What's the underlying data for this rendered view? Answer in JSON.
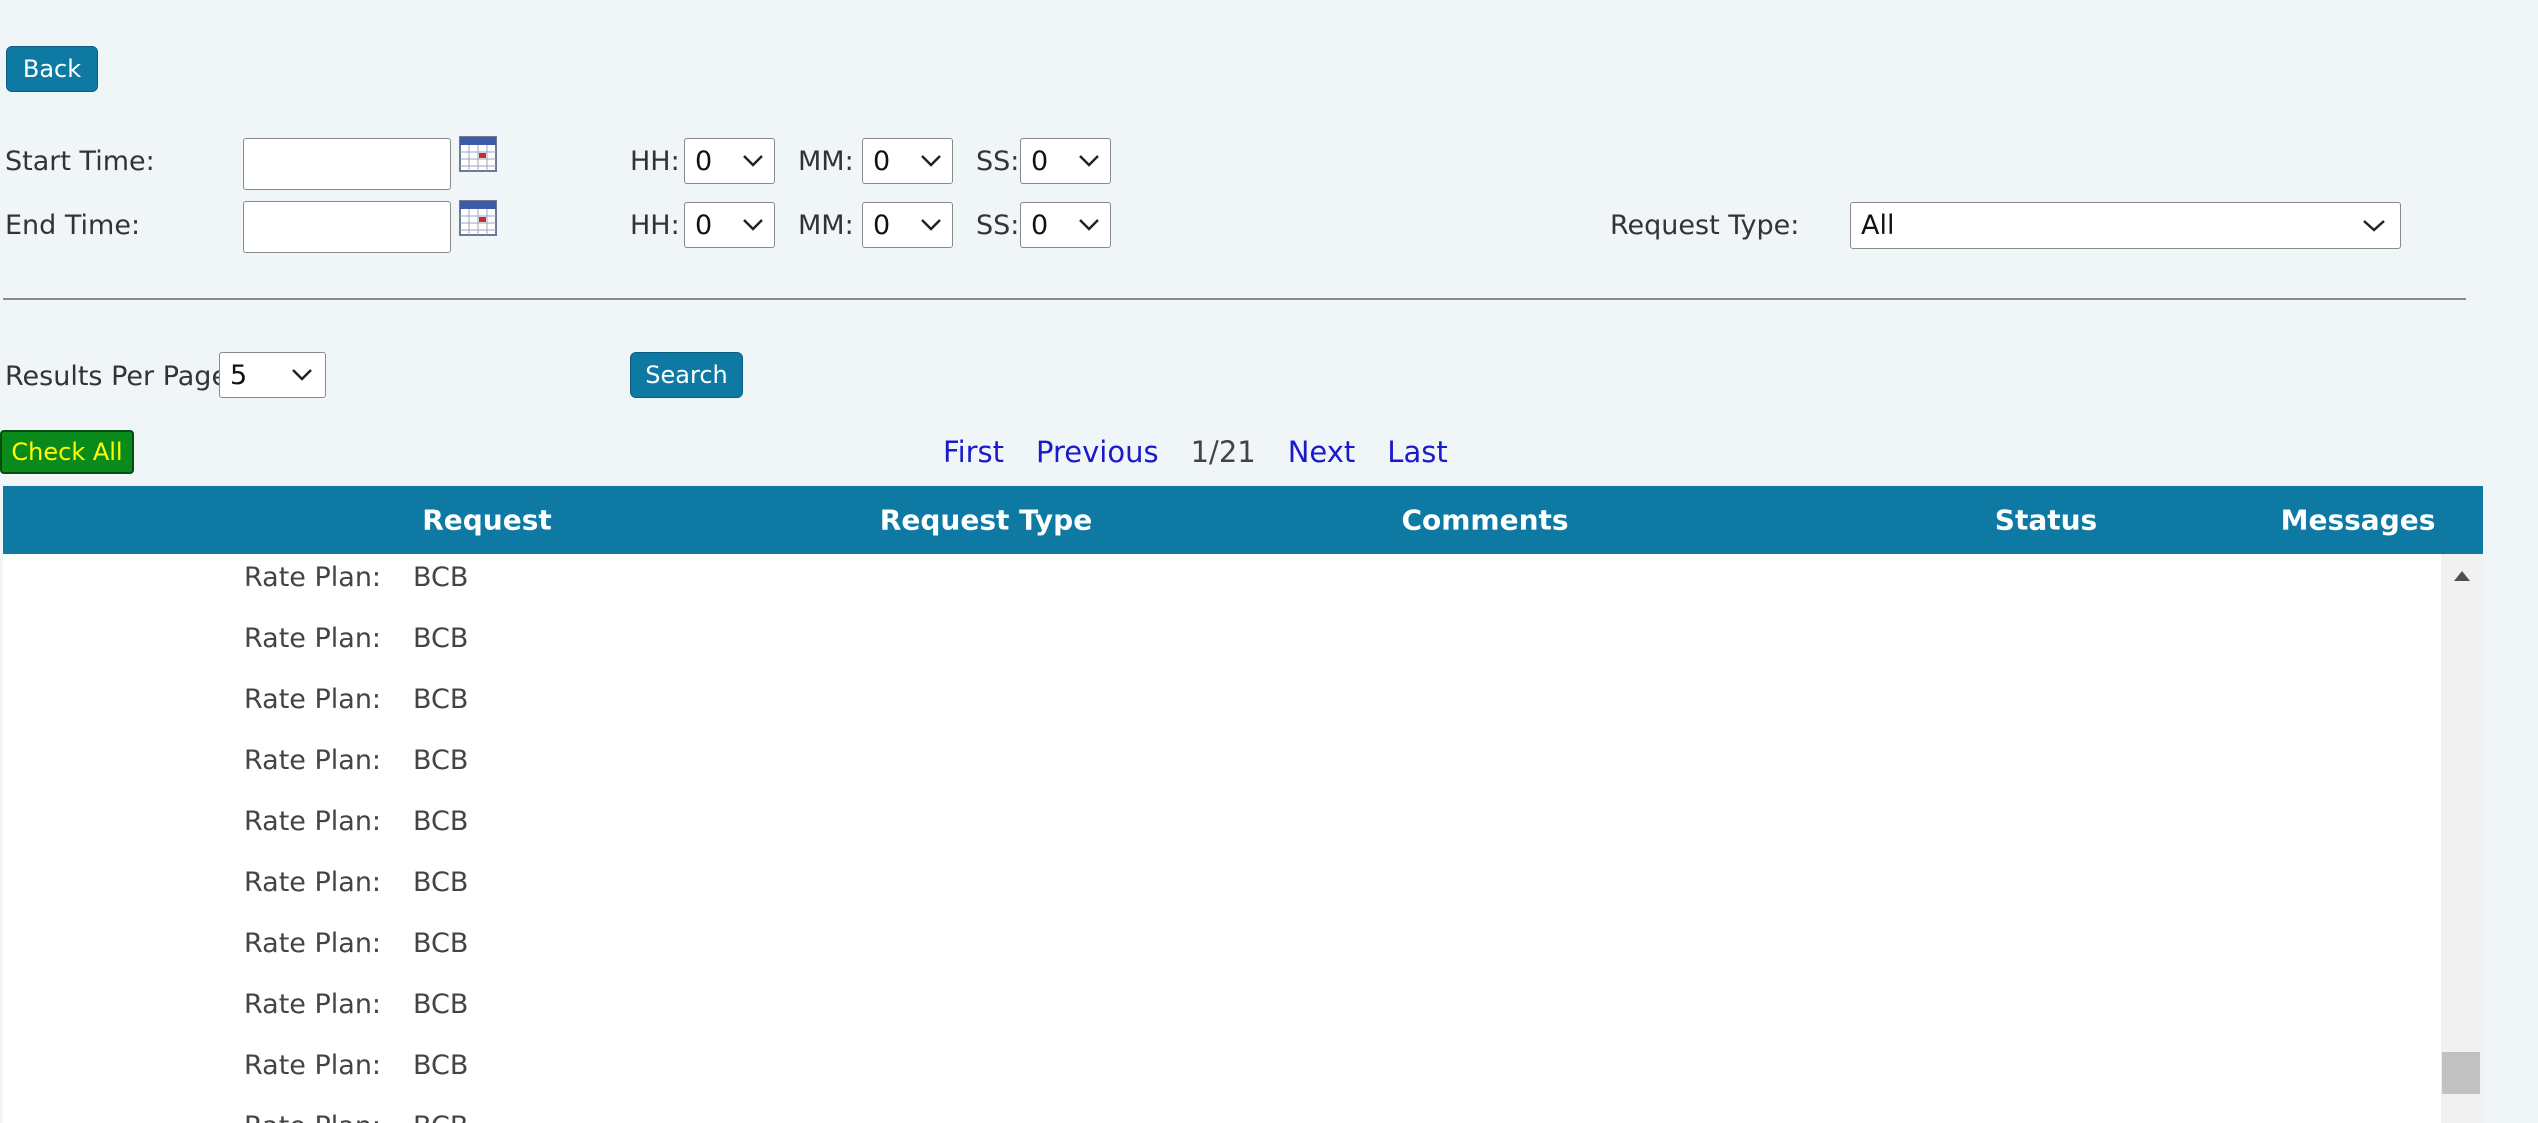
{
  "toolbar": {
    "back_label": "Back"
  },
  "filters": {
    "start_time_label": "Start Time:",
    "end_time_label": "End Time:",
    "hh_label": "HH:",
    "mm_label": "MM:",
    "ss_label": "SS:",
    "start": {
      "date": "",
      "hh": "0",
      "mm": "0",
      "ss": "0"
    },
    "end": {
      "date": "",
      "hh": "0",
      "mm": "0",
      "ss": "0"
    },
    "request_type_label": "Request Type:",
    "request_type_value": "All",
    "results_per_page_label": "Results Per Page:",
    "results_per_page_value": "5",
    "search_label": "Search"
  },
  "actions": {
    "check_all_label": "Check All"
  },
  "pager": {
    "first": "First",
    "previous": "Previous",
    "current": "1/21",
    "next": "Next",
    "last": "Last"
  },
  "table": {
    "columns": [
      "Request",
      "Request Type",
      "Comments",
      "Status",
      "Messages"
    ],
    "rows": [
      {
        "key": "Rate Plan:",
        "value": "BCB"
      },
      {
        "key": "Rate Plan:",
        "value": "BCB"
      },
      {
        "key": "Rate Plan:",
        "value": "BCB"
      },
      {
        "key": "Rate Plan:",
        "value": "BCB"
      },
      {
        "key": "Rate Plan:",
        "value": "BCB"
      },
      {
        "key": "Rate Plan:",
        "value": "BCB"
      },
      {
        "key": "Rate Plan:",
        "value": "BCB"
      },
      {
        "key": "Rate Plan:",
        "value": "BCB"
      },
      {
        "key": "Rate Plan:",
        "value": "BCB"
      },
      {
        "key": "Rate Plan:",
        "value": "BCB"
      }
    ]
  },
  "colors": {
    "accent": "#0e7aa3",
    "check_all_bg": "#0a8a1a",
    "check_all_text": "#ffff00",
    "link": "#1a1acc"
  }
}
